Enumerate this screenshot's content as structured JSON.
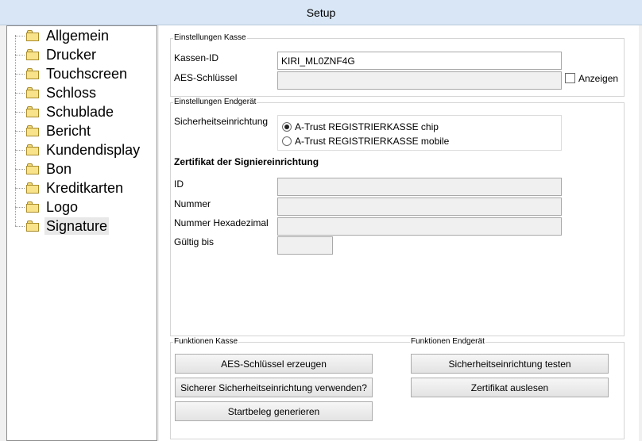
{
  "window": {
    "title": "Setup"
  },
  "tree": {
    "items": [
      {
        "label": "Allgemein"
      },
      {
        "label": "Drucker"
      },
      {
        "label": "Touchscreen"
      },
      {
        "label": "Schloss"
      },
      {
        "label": "Schublade"
      },
      {
        "label": "Bericht"
      },
      {
        "label": "Kundendisplay"
      },
      {
        "label": "Bon"
      },
      {
        "label": "Kreditkarten"
      },
      {
        "label": "Logo"
      },
      {
        "label": "Signature",
        "selected": true
      }
    ]
  },
  "kasse": {
    "group_title": "Einstellungen Kasse",
    "kassen_id_label": "Kassen-ID",
    "kassen_id_value": "KIRI_ML0ZNF4G",
    "aes_label": "AES-Schlüssel",
    "aes_value": "",
    "anzeigen_label": "Anzeigen",
    "anzeigen_checked": false
  },
  "endgeraet": {
    "group_title": "Einstellungen Endgerät",
    "sicherheit_label": "Sicherheitseinrichtung",
    "options": [
      {
        "label": "A-Trust REGISTRIERKASSE chip",
        "checked": true
      },
      {
        "label": "A-Trust REGISTRIERKASSE mobile",
        "checked": false
      }
    ],
    "zertifikat_heading": "Zertifikat der Signiereinrichtung",
    "id_label": "ID",
    "nummer_label": "Nummer",
    "nummer_hex_label": "Nummer Hexadezimal",
    "gueltig_label": "Gültig bis"
  },
  "funktionen_kasse": {
    "group_title": "Funktionen Kasse",
    "btn_aes": "AES-Schlüssel erzeugen",
    "btn_sicherer": "Sicherer Sicherheitseinrichtung verwenden?",
    "btn_startbeleg": "Startbeleg generieren"
  },
  "funktionen_endgeraet": {
    "group_title": "Funktionen Endgerät",
    "btn_testen": "Sicherheitseinrichtung testen",
    "btn_zertifikat": "Zertifikat auslesen"
  }
}
